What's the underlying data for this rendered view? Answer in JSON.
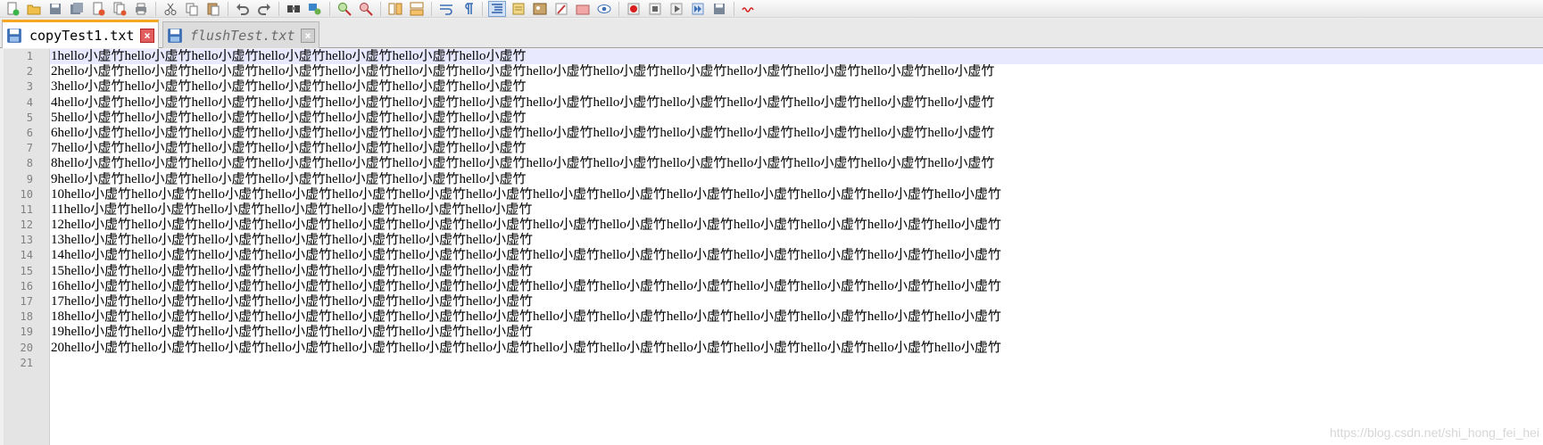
{
  "toolbar": {
    "buttons": [
      {
        "name": "new-file-icon"
      },
      {
        "name": "open-file-icon"
      },
      {
        "name": "save-icon"
      },
      {
        "name": "save-all-icon"
      },
      {
        "name": "close-file-icon"
      },
      {
        "name": "close-all-icon"
      },
      {
        "name": "print-icon"
      },
      {
        "sep": true
      },
      {
        "name": "cut-icon"
      },
      {
        "name": "copy-icon"
      },
      {
        "name": "paste-icon"
      },
      {
        "sep": true
      },
      {
        "name": "undo-icon"
      },
      {
        "name": "redo-icon"
      },
      {
        "sep": true
      },
      {
        "name": "find-icon"
      },
      {
        "name": "replace-icon"
      },
      {
        "sep": true
      },
      {
        "name": "zoom-in-icon"
      },
      {
        "name": "zoom-out-icon"
      },
      {
        "sep": true
      },
      {
        "name": "sync-vertical-icon"
      },
      {
        "name": "sync-horizontal-icon"
      },
      {
        "sep": true
      },
      {
        "name": "word-wrap-icon"
      },
      {
        "name": "show-all-chars-icon"
      },
      {
        "sep": true
      },
      {
        "name": "indent-guide-icon",
        "active": true
      },
      {
        "name": "language-icon"
      },
      {
        "name": "image-icon"
      },
      {
        "name": "pen-icon"
      },
      {
        "name": "folder-icon"
      },
      {
        "name": "eye-icon"
      },
      {
        "sep": true
      },
      {
        "name": "record-macro-icon"
      },
      {
        "name": "stop-macro-icon"
      },
      {
        "name": "play-macro-icon"
      },
      {
        "name": "run-macro-multiple-icon"
      },
      {
        "name": "save-macro-icon"
      },
      {
        "sep": true
      },
      {
        "name": "spell-check-icon"
      }
    ]
  },
  "tabs": [
    {
      "label": "copyTest1.txt",
      "state": "active",
      "close": "×"
    },
    {
      "label": "flushTest.txt",
      "state": "inactive",
      "close": "×"
    }
  ],
  "editor": {
    "line_numbers": [
      "1",
      "2",
      "3",
      "4",
      "5",
      "6",
      "7",
      "8",
      "9",
      "10",
      "11",
      "12",
      "13",
      "14",
      "15",
      "16",
      "17",
      "18",
      "19",
      "20",
      "21"
    ],
    "lines": [
      "1hello小虚竹hello小虚竹hello小虚竹hello小虚竹hello小虚竹hello小虚竹hello小虚竹",
      "2hello小虚竹hello小虚竹hello小虚竹hello小虚竹hello小虚竹hello小虚竹hello小虚竹hello小虚竹hello小虚竹hello小虚竹hello小虚竹hello小虚竹hello小虚竹hello小虚竹",
      "3hello小虚竹hello小虚竹hello小虚竹hello小虚竹hello小虚竹hello小虚竹hello小虚竹",
      "4hello小虚竹hello小虚竹hello小虚竹hello小虚竹hello小虚竹hello小虚竹hello小虚竹hello小虚竹hello小虚竹hello小虚竹hello小虚竹hello小虚竹hello小虚竹hello小虚竹",
      "5hello小虚竹hello小虚竹hello小虚竹hello小虚竹hello小虚竹hello小虚竹hello小虚竹",
      "6hello小虚竹hello小虚竹hello小虚竹hello小虚竹hello小虚竹hello小虚竹hello小虚竹hello小虚竹hello小虚竹hello小虚竹hello小虚竹hello小虚竹hello小虚竹hello小虚竹",
      "7hello小虚竹hello小虚竹hello小虚竹hello小虚竹hello小虚竹hello小虚竹hello小虚竹",
      "8hello小虚竹hello小虚竹hello小虚竹hello小虚竹hello小虚竹hello小虚竹hello小虚竹hello小虚竹hello小虚竹hello小虚竹hello小虚竹hello小虚竹hello小虚竹hello小虚竹",
      "9hello小虚竹hello小虚竹hello小虚竹hello小虚竹hello小虚竹hello小虚竹hello小虚竹",
      "10hello小虚竹hello小虚竹hello小虚竹hello小虚竹hello小虚竹hello小虚竹hello小虚竹hello小虚竹hello小虚竹hello小虚竹hello小虚竹hello小虚竹hello小虚竹hello小虚竹",
      "11hello小虚竹hello小虚竹hello小虚竹hello小虚竹hello小虚竹hello小虚竹hello小虚竹",
      "12hello小虚竹hello小虚竹hello小虚竹hello小虚竹hello小虚竹hello小虚竹hello小虚竹hello小虚竹hello小虚竹hello小虚竹hello小虚竹hello小虚竹hello小虚竹hello小虚竹",
      "13hello小虚竹hello小虚竹hello小虚竹hello小虚竹hello小虚竹hello小虚竹hello小虚竹",
      "14hello小虚竹hello小虚竹hello小虚竹hello小虚竹hello小虚竹hello小虚竹hello小虚竹hello小虚竹hello小虚竹hello小虚竹hello小虚竹hello小虚竹hello小虚竹hello小虚竹",
      "15hello小虚竹hello小虚竹hello小虚竹hello小虚竹hello小虚竹hello小虚竹hello小虚竹",
      "16hello小虚竹hello小虚竹hello小虚竹hello小虚竹hello小虚竹hello小虚竹hello小虚竹hello小虚竹hello小虚竹hello小虚竹hello小虚竹hello小虚竹hello小虚竹hello小虚竹",
      "17hello小虚竹hello小虚竹hello小虚竹hello小虚竹hello小虚竹hello小虚竹hello小虚竹",
      "18hello小虚竹hello小虚竹hello小虚竹hello小虚竹hello小虚竹hello小虚竹hello小虚竹hello小虚竹hello小虚竹hello小虚竹hello小虚竹hello小虚竹hello小虚竹hello小虚竹",
      "19hello小虚竹hello小虚竹hello小虚竹hello小虚竹hello小虚竹hello小虚竹hello小虚竹",
      "20hello小虚竹hello小虚竹hello小虚竹hello小虚竹hello小虚竹hello小虚竹hello小虚竹hello小虚竹hello小虚竹hello小虚竹hello小虚竹hello小虚竹hello小虚竹hello小虚竹",
      ""
    ],
    "current_line": 1
  },
  "watermark": "https://blog.csdn.net/shi_hong_fei_hei",
  "colors": {
    "accent_tab": "#f5a623",
    "current_line": "#e8e8ff",
    "gutter": "#e4e4e4",
    "close_active": "#e25d5d"
  }
}
